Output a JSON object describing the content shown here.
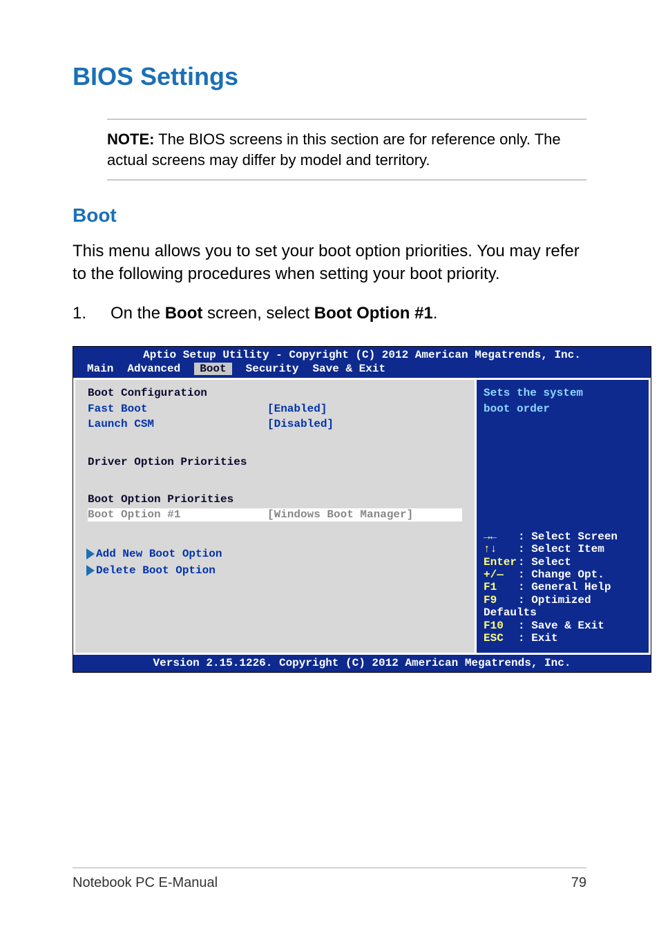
{
  "title": "BIOS Settings",
  "note": {
    "label": "NOTE:",
    "text": " The BIOS screens in this section are for reference only. The actual screens may differ by model and territory."
  },
  "section": {
    "title": "Boot",
    "intro": "This menu allows you to set your boot option priorities. You may refer to the following procedures when setting your boot priority.",
    "step_num": "1.",
    "step_prefix": "On the ",
    "step_bold1": "Boot",
    "step_mid": " screen, select ",
    "step_bold2": "Boot Option #1",
    "step_suffix": "."
  },
  "bios": {
    "header": "Aptio Setup Utility - Copyright (C) 2012 American Megatrends, Inc.",
    "tabs": {
      "main": "Main",
      "advanced": "Advanced",
      "boot": "Boot",
      "security": "Security",
      "save_exit": "Save & Exit"
    },
    "left": {
      "cfg_title": "Boot Configuration",
      "fast_boot_label": "Fast Boot",
      "fast_boot_value": "[Enabled]",
      "launch_csm_label": "Launch CSM",
      "launch_csm_value": "[Disabled]",
      "driver_prio": "Driver Option Priorities",
      "boot_prio": "Boot Option Priorities",
      "boot_opt1_label": "Boot Option #1",
      "boot_opt1_value": "[Windows Boot Manager]",
      "add_new": "Add New Boot Option",
      "delete": "Delete Boot Option"
    },
    "right": {
      "help_line1": "Sets the system",
      "help_line2": "boot order",
      "keys": {
        "arrows_lr": "→←",
        "arrows_lr_desc": ": Select Screen",
        "arrows_ud": "↑↓",
        "arrows_ud_desc": ": Select Item",
        "enter": "Enter",
        "enter_desc": ": Select",
        "pm": "+/—",
        "pm_desc": ": Change Opt.",
        "f1": "F1",
        "f1_desc": ": General Help",
        "f9": "F9",
        "f9_desc": ": Optimized Defaults",
        "f10": "F10",
        "f10_desc": ": Save & Exit",
        "esc": "ESC",
        "esc_desc": ": Exit"
      }
    },
    "footer": "Version 2.15.1226. Copyright (C) 2012 American Megatrends, Inc."
  },
  "page_footer": {
    "left": "Notebook PC E-Manual",
    "right": "79"
  }
}
